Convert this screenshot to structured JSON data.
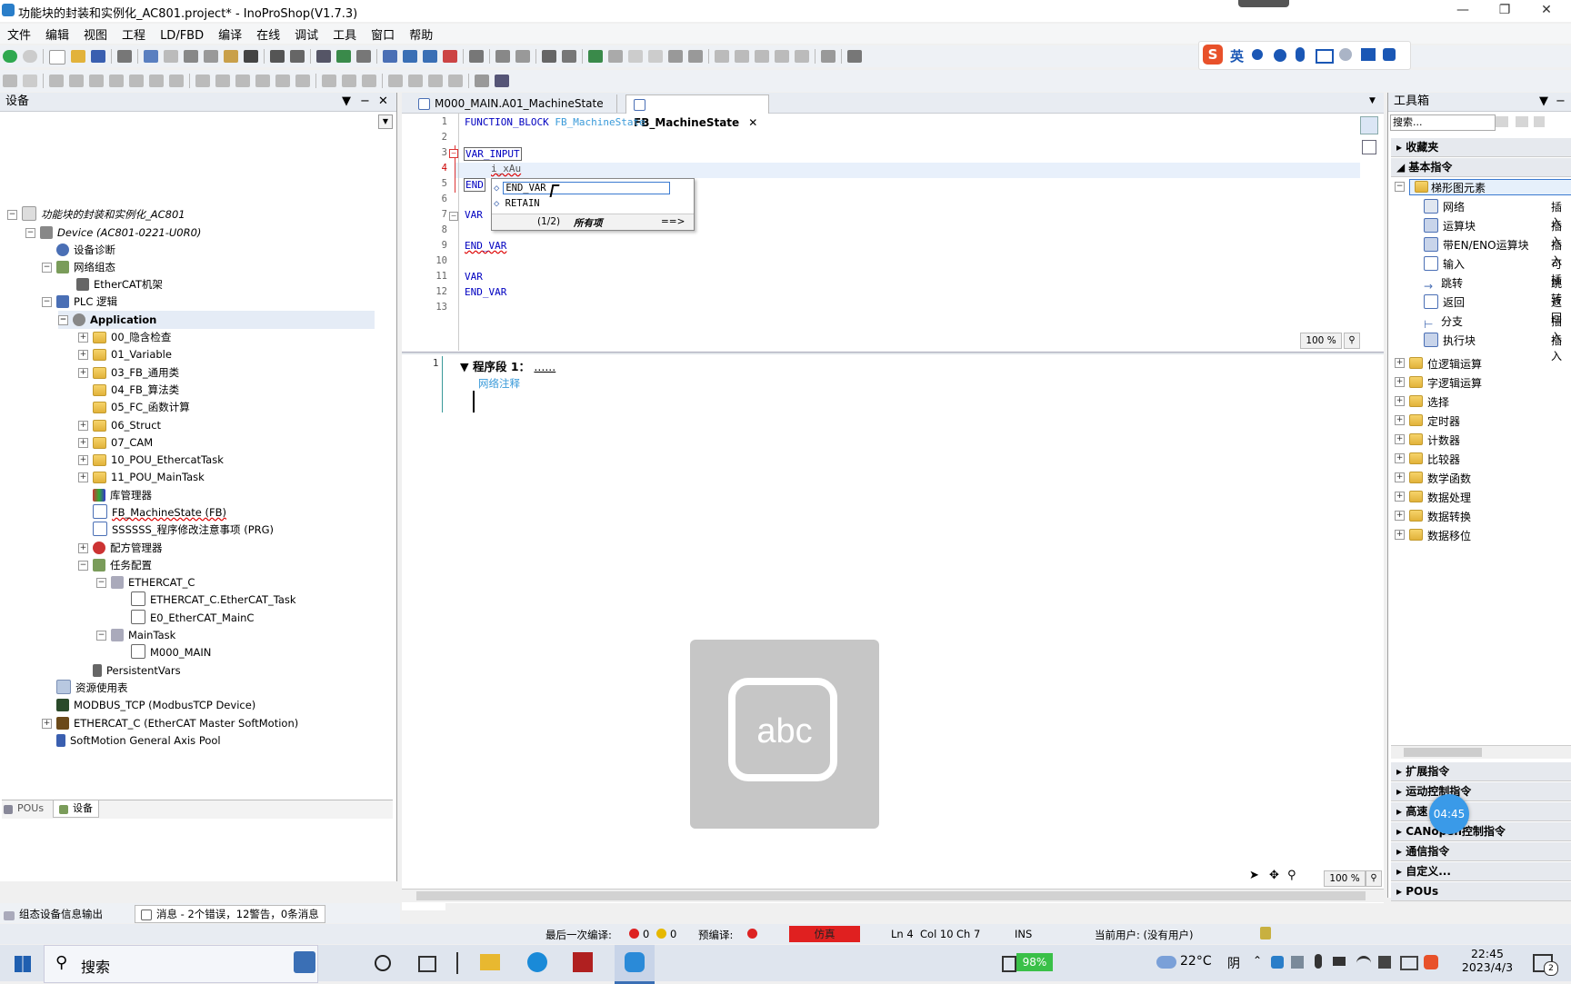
{
  "window": {
    "title": "功能块的封装和实例化_AC801.project* - InoProShop(V1.7.3)"
  },
  "menu": [
    "文件",
    "编辑",
    "视图",
    "工程",
    "LD/FBD",
    "编译",
    "在线",
    "调试",
    "工具",
    "窗口",
    "帮助"
  ],
  "ime": {
    "lang": "英"
  },
  "left_panel": {
    "title": "设备",
    "tree": [
      "功能块的封装和实例化_AC801",
      "Device (AC801-0221-U0R0)",
      "设备诊断",
      "网络组态",
      "EtherCAT机架",
      "PLC 逻辑",
      "Application",
      "00_隐含检查",
      "01_Variable",
      "03_FB_通用类",
      "04_FB_算法类",
      "05_FC_函数计算",
      "06_Struct",
      "07_CAM",
      "10_POU_EthercatTask",
      "11_POU_MainTask",
      "库管理器",
      "FB_MachineState (FB)",
      "SSSSSS_程序修改注意事项 (PRG)",
      "配方管理器",
      "任务配置",
      "ETHERCAT_C",
      "ETHERCAT_C.EtherCAT_Task",
      "E0_EtherCAT_MainC",
      "MainTask",
      "M000_MAIN",
      "PersistentVars",
      "资源使用表",
      "MODBUS_TCP (ModbusTCP Device)",
      "ETHERCAT_C (EtherCAT Master SoftMotion)",
      "SoftMotion General Axis Pool"
    ],
    "bottom_tabs": [
      "POUs",
      "设备"
    ]
  },
  "editor": {
    "tabs": [
      "M000_MAIN.A01_MachineState",
      "FB_MachineState"
    ],
    "line_numbers": [
      "1",
      "2",
      "3",
      "4",
      "5",
      "6",
      "7",
      "8",
      "9",
      "10",
      "11",
      "12",
      "13"
    ],
    "lines": {
      "l1a": "FUNCTION_BLOCK",
      "l1b": "FB_MachineState",
      "l3": "VAR_INPUT",
      "l4": "i_xAu",
      "l5": "END",
      "l7": "VAR",
      "l9": "END_VAR",
      "l11": "VAR",
      "l12": "END_VAR"
    },
    "autocomplete": {
      "items": [
        "END_VAR",
        "RETAIN"
      ],
      "footer_page": "(1/2)",
      "footer_label": "所有项",
      "footer_next": "==>"
    },
    "zoom": "100 %",
    "network": {
      "number": "1",
      "header": "程序段 1：",
      "dots": "......",
      "comment": "网络注释"
    },
    "lower_zoom": "100 %",
    "overlay_text": "abc"
  },
  "right_panel": {
    "title": "工具箱",
    "search_placeholder": "搜索...",
    "favorites": "收藏夹",
    "basic": "基本指令",
    "ladder_group": "梯形图元素",
    "ladder_items": [
      {
        "label": "网络",
        "action": "插入"
      },
      {
        "label": "运算块",
        "action": "插入"
      },
      {
        "label": "带EN/ENO运算块",
        "action": "插入"
      },
      {
        "label": "输入",
        "action": "可插"
      },
      {
        "label": "跳转",
        "action": "跳转"
      },
      {
        "label": "返回",
        "action": "返回"
      },
      {
        "label": "分支",
        "action": "插入"
      },
      {
        "label": "执行块",
        "action": "插入"
      }
    ],
    "folders": [
      "位逻辑运算",
      "字逻辑运算",
      "选择",
      "定时器",
      "计数器",
      "比较器",
      "数学函数",
      "数据处理",
      "数据转换",
      "数据移位"
    ],
    "categories": [
      "扩展指令",
      "运动控制指令",
      "高速",
      "CANopen控制指令",
      "通信指令",
      "自定义...",
      "POUs"
    ],
    "timer_badge": "04:45"
  },
  "messages": {
    "tab1": "组态设备信息输出",
    "tab2": "消息 - 2个错误，12警告，0条消息"
  },
  "status": {
    "last_compile": "最后一次编译:",
    "errors": "0",
    "warnings": "0",
    "precompile": "预编译:",
    "sim": "仿真",
    "ln": "Ln 4",
    "col": "Col 10",
    "ch": "Ch 7",
    "ins": "INS",
    "user": "当前用户: (没有用户)"
  },
  "taskbar": {
    "search": "搜索",
    "battery": "98%",
    "weather_temp": "22°C",
    "weather_cond": "阴",
    "time": "22:45",
    "date": "2023/4/3",
    "notify_count": "2"
  }
}
